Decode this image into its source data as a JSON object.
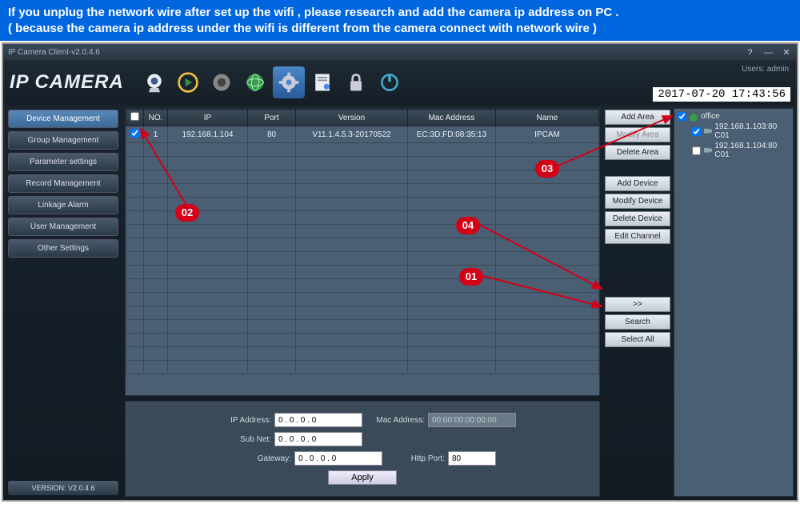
{
  "banner_line1": "If you unplug the network wire after set up the wifi , please research and add the camera ip address on PC .",
  "banner_line2": "( because the camera ip address under the wifi  is different from the camera connect with network wire )",
  "window_title": "IP Camera Client-v2.0.4.6",
  "logo_text": "IP CAMERA",
  "user_label": "Users: admin",
  "clock": "2017-07-20 17:43:56",
  "nav": {
    "device": "Device Management",
    "group": "Group Management",
    "param": "Parameter settings",
    "record": "Record Management",
    "linkage": "Linkage Alarm",
    "user": "User Management",
    "other": "Other Settings"
  },
  "version_label": "VERSION: V2.0.4.6",
  "columns": {
    "chk": "",
    "no": "NO.",
    "ip": "IP",
    "port": "Port",
    "version": "Version",
    "mac": "Mac Address",
    "name": "Name"
  },
  "row1": {
    "no": "1",
    "ip": "192.168.1.104",
    "port": "80",
    "version": "V11.1.4.5.3-20170522",
    "mac": "EC:3D:FD:08:35:13",
    "name": "IPCAM"
  },
  "sidebtns": {
    "add_area": "Add Area",
    "modify_area": "Modify Area",
    "delete_area": "Delete Area",
    "add_device": "Add Device",
    "modify_device": "Modify Device",
    "delete_device": "Delete Device",
    "edit_channel": "Edit Channel",
    "move": ">>",
    "search": "Search",
    "select_all": "Select All"
  },
  "tree": {
    "root": "office",
    "child1": "192.168.1.103:80 C01",
    "child2": "192.168.1.104:80 C01"
  },
  "form": {
    "ip_label": "IP Address:",
    "ip_value": "0 . 0 . 0 . 0",
    "sub_label": "Sub Net:",
    "sub_value": "0 . 0 . 0 . 0",
    "gw_label": "Gateway:",
    "gw_value": "0 . 0 . 0 . 0",
    "mac_label": "Mac Address:",
    "mac_value": "00:00:00:00:00:00",
    "http_label": "Http Port:",
    "http_value": "80",
    "apply": "Apply"
  },
  "annotations": {
    "b1": "01",
    "b2": "02",
    "b3": "03",
    "b4": "04"
  }
}
